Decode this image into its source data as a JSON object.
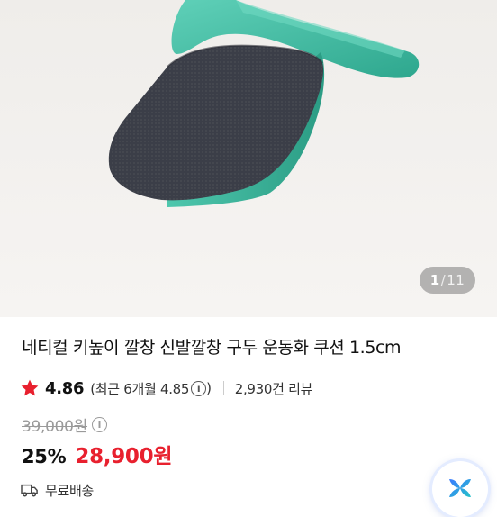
{
  "gallery": {
    "current": "1",
    "separator": "/",
    "total": "11"
  },
  "product": {
    "title": "네티컬 키높이 깔창 신발깔창 구두 운동화 쿠션 1.5cm",
    "rating": "4.86",
    "recent_rating": "(최근 6개월 4.85",
    "recent_rating_close": ")",
    "review_count": "2,930건 리뷰",
    "original_price": "39,000원",
    "discount": "25%",
    "sale_price": "28,900원",
    "shipping": "무료배송"
  },
  "icons": {
    "star": "star-icon",
    "info": "info-icon",
    "truck": "truck-icon",
    "fab": "ai-assistant-icon"
  },
  "colors": {
    "sale_red": "#e8202e",
    "star_red": "#e8202e",
    "insole_teal": "#3fbfa4",
    "insole_dark": "#3a3d47"
  }
}
